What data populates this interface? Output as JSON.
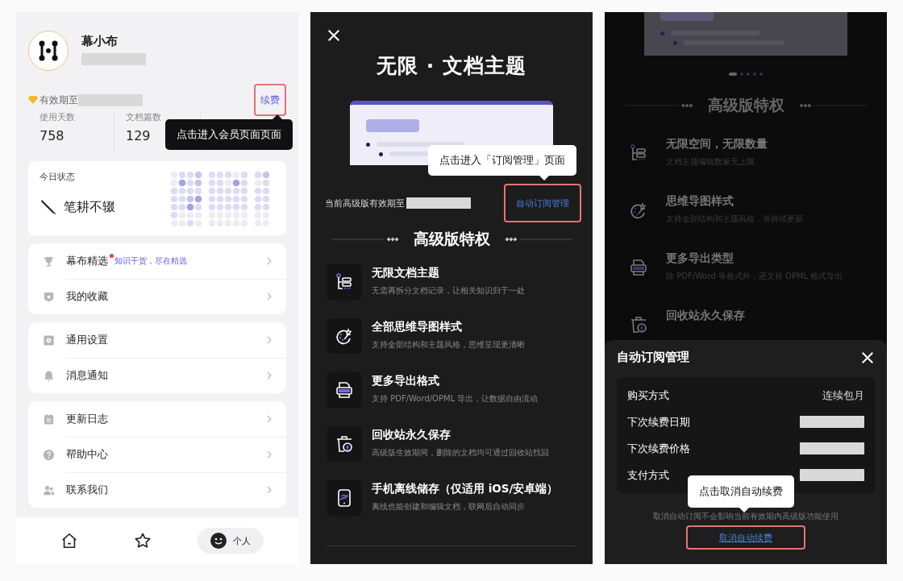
{
  "profile_screen": {
    "user": {
      "name": "幕小布"
    },
    "membership": {
      "label": "有效期至",
      "renew_link": "续费"
    },
    "stats": [
      {
        "label": "使用天数",
        "value": "758"
      },
      {
        "label": "文档篇数",
        "value": "129"
      }
    ],
    "tooltip": "点击进入会员页面页面",
    "today_card": {
      "title": "今日状态",
      "status": "笔耕不辍"
    },
    "menu_groups": [
      [
        {
          "label": "幕布精选",
          "new": true,
          "hint": "知识干货，尽在精选"
        },
        {
          "label": "我的收藏",
          "new": false
        }
      ],
      [
        {
          "label": "通用设置",
          "new": false
        },
        {
          "label": "消息通知",
          "new": false
        }
      ],
      [
        {
          "label": "更新日志",
          "new": false
        },
        {
          "label": "帮助中心",
          "new": false
        },
        {
          "label": "联系我们",
          "new": false
        }
      ]
    ],
    "nav": [
      {
        "selected": false
      },
      {
        "selected": false
      },
      {
        "label": "个人",
        "selected": true
      }
    ]
  },
  "premium_screen": {
    "headline": "无限 · 文档主题",
    "tooltip": "点击进入「订阅管理」页面",
    "expiry_label": "当前高级版有效期至",
    "manage_link": "自动订阅管理",
    "section_title": "高级版特权",
    "features": [
      {
        "title": "无限文档主题",
        "desc": "无需再拆分文档记录，让相关知识归于一处"
      },
      {
        "title": "全部思维导图样式",
        "desc": "支持全部结构和主题风格，思维呈现更清晰"
      },
      {
        "title": "更多导出格式",
        "desc": "支持 PDF/Word/OPML 导出，让数据自由流动"
      },
      {
        "title": "回收站永久保存",
        "desc": "高级版生效期间，删除的文档均可通过回收站找回"
      },
      {
        "title": "手机离线储存（仅适用 iOS/安卓端）",
        "desc": "离线也能创建和编辑文档，联网后自动同步"
      }
    ]
  },
  "subscription_screen": {
    "carousel": [
      {
        "selected": true
      },
      {
        "selected": false
      },
      {
        "selected": false
      },
      {
        "selected": false
      },
      {
        "selected": false
      }
    ],
    "section_title": "高级版特权",
    "features": [
      {
        "title": "无限空间，无限数量",
        "desc": "文档主题编辑数量无上限"
      },
      {
        "title": "思维导图样式",
        "desc": "支持全部结构和主题风格，并持续更新"
      },
      {
        "title": "更多导出类型",
        "desc": "除 PDF/Word 等格式外，还支持 OPML 格式导出"
      },
      {
        "title": "回收站永久保存"
      }
    ],
    "sheet": {
      "title": "自动订阅管理",
      "rows": [
        {
          "label": "购买方式",
          "value": "连续包月"
        },
        {
          "label": "下次续费日期"
        },
        {
          "label": "下次续费价格"
        },
        {
          "label": "支付方式"
        }
      ],
      "note": "取消自动订阅不会影响当前有效期内高级版功能使用",
      "cancel_link": "取消自动续费",
      "tooltip": "点击取消自动续费"
    }
  }
}
